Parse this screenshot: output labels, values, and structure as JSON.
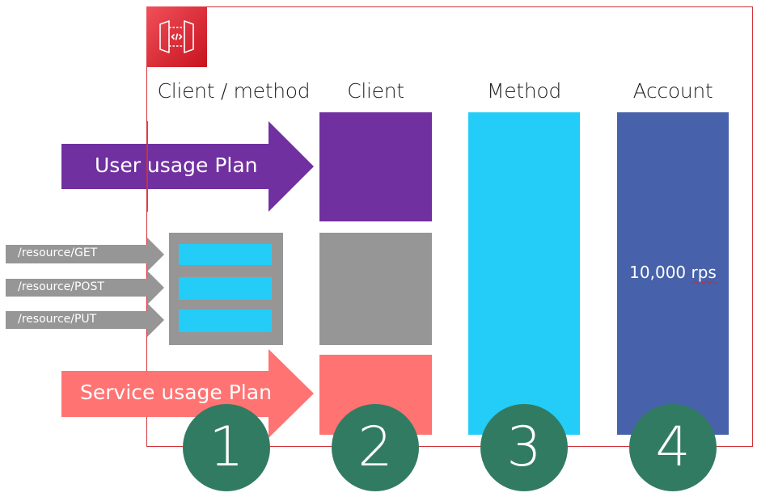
{
  "diagram": {
    "title_icon": "api-gateway-icon",
    "columns": [
      {
        "id": "client-method",
        "header": "Client / method",
        "badge": "1"
      },
      {
        "id": "client",
        "header": "Client",
        "badge": "2"
      },
      {
        "id": "method",
        "header": "Method",
        "badge": "3"
      },
      {
        "id": "account",
        "header": "Account",
        "badge": "4"
      }
    ],
    "arrows": {
      "user_plan": "User usage Plan",
      "service_plan": "Service usage Plan",
      "resources": [
        "/resource/GET",
        "/resource/POST",
        "/resource/PUT"
      ]
    },
    "account_limit": {
      "value": "10,000",
      "unit": "rps"
    },
    "colors": {
      "frame": "#d13239",
      "user_plan": "#7030a0",
      "resource_group": "#969696",
      "service_plan": "#ff7373",
      "method": "#23cdf7",
      "account": "#4761aa",
      "badge": "#327b63",
      "logo": "#d9232e"
    }
  }
}
